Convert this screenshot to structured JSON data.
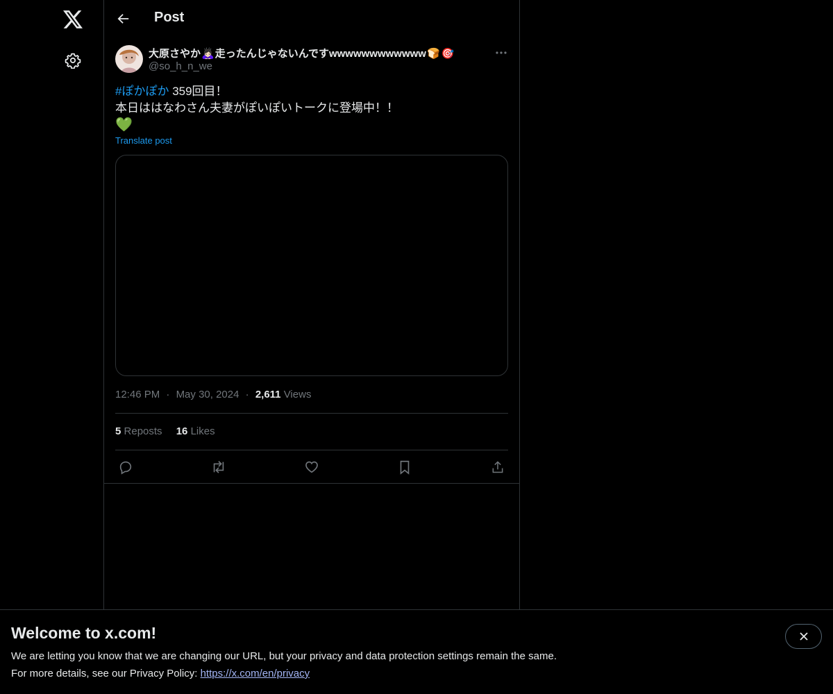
{
  "icons": {
    "logo": "x-logo-icon",
    "settings": "gear-icon",
    "back": "arrow-left-icon",
    "more": "more-horizontal-icon",
    "reply": "reply-icon",
    "repost": "repost-icon",
    "like": "heart-icon",
    "bookmark": "bookmark-icon",
    "share": "share-icon",
    "close": "close-icon"
  },
  "colors": {
    "accent": "#1d9bf0",
    "secondary_text": "#71767b",
    "border": "#2f3336"
  },
  "header": {
    "title": "Post"
  },
  "post": {
    "author": {
      "display_name_part1": "大原さやか",
      "emoji1": "🙇🏻‍♀️",
      "display_name_part2": "走ったんじゃないんですwwwwwwwwwwww",
      "emoji2": "🍞",
      "emoji3": "🎯",
      "handle": "@so_h_n_we"
    },
    "hashtag": "#ぽかぽか",
    "line1_rest": " 359回目！",
    "line2": "本日ははなわさん夫妻がぽいぽいトークに登場中！！",
    "line3_emoji": "💚",
    "translate_label": "Translate post",
    "time": "12:46 PM",
    "dot1": "·",
    "date": "May 30, 2024",
    "dot2": "·",
    "views_count": "2,611",
    "views_label": "Views",
    "reposts_count": "5",
    "reposts_label": "Reposts",
    "likes_count": "16",
    "likes_label": "Likes"
  },
  "banner": {
    "title": "Welcome to x.com!",
    "line1": "We are letting you know that we are changing our URL, but your privacy and data protection settings remain the same.",
    "line2_prefix": "For more details, see our Privacy Policy: ",
    "line2_link": "https://x.com/en/privacy"
  }
}
